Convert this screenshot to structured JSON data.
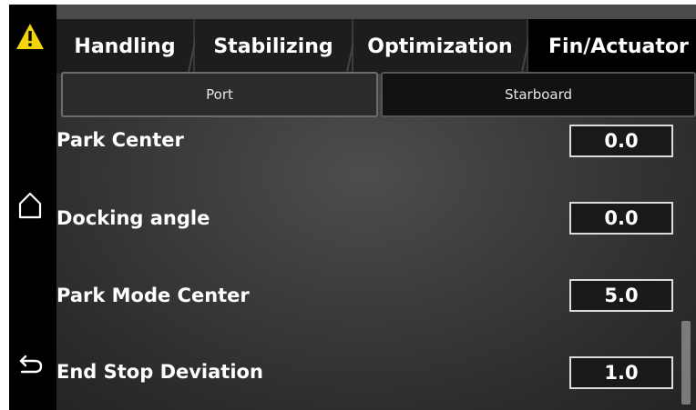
{
  "tabs": [
    "Handling",
    "Stabilizing",
    "Optimization",
    "Fin/Actuator"
  ],
  "active_tab": "Fin/Actuator",
  "segments": {
    "port": "Port",
    "starboard": "Starboard"
  },
  "rows": [
    {
      "label": "Park Center",
      "value": "0.0"
    },
    {
      "label": "Docking angle",
      "value": "0.0"
    },
    {
      "label": "Park Mode Center",
      "value": "5.0"
    },
    {
      "label": "End Stop Deviation",
      "value": "1.0"
    }
  ],
  "icons": {
    "warning": "warning-triangle-icon",
    "home": "home-icon",
    "back": "back-arrow-icon"
  },
  "colors": {
    "warning": "#f2d40a",
    "background": "#3a3a3a",
    "tab_bg": "#1d1d1d"
  }
}
